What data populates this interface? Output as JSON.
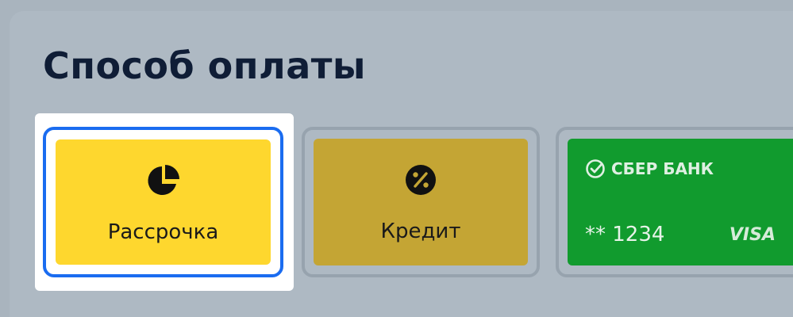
{
  "payment": {
    "title": "Способ оплаты",
    "options": [
      {
        "label": "Рассрочка",
        "icon": "pie-chart-icon",
        "selected": true,
        "color": "#fed72e"
      },
      {
        "label": "Кредит",
        "icon": "percent-icon",
        "selected": false,
        "color": "#c4a534"
      },
      {
        "bank_name": "СБЕР БАНК",
        "bank_icon": "check-circle-icon",
        "card_number": "** 1234",
        "network": "VISA",
        "selected": false,
        "color": "#119b2e"
      }
    ]
  },
  "colors": {
    "selection_outline": "#1a6cf0",
    "title_text": "#0f1d36",
    "background": "#aeb9c3"
  }
}
